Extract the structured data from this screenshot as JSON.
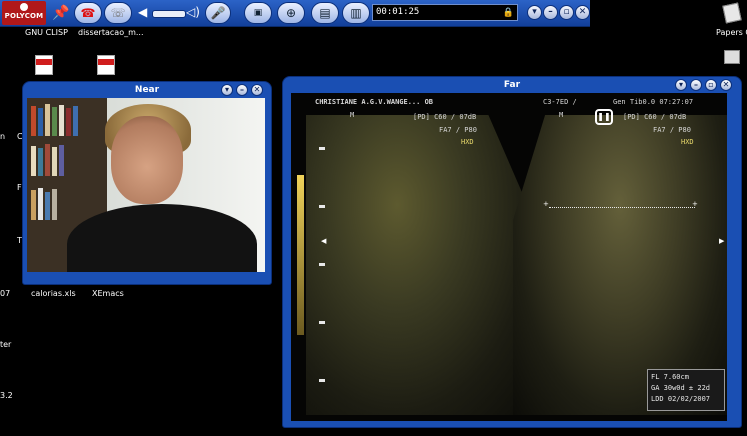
{
  "toolbar": {
    "logo_text": "POLYCOM",
    "timer": "00:01:25",
    "icons": [
      "pin-icon",
      "hangup-icon",
      "dial-icon",
      "speaker-icon",
      "volume-slider",
      "mic-icon",
      "near-camera-icon",
      "far-camera-icon",
      "pc-content-icon",
      "monitor-icon",
      "lock-icon"
    ],
    "window_buttons": [
      "▾",
      "–",
      "▫",
      "✕"
    ]
  },
  "desktop": {
    "icons": [
      {
        "label": "GNU CLISP"
      },
      {
        "label": "dissertacao_m..."
      },
      {
        "label": "calorias.xls"
      },
      {
        "label": "XEmacs"
      },
      {
        "label": "Papers C"
      }
    ],
    "edge_labels": [
      "n",
      "C",
      "T",
      "F",
      "T",
      "07",
      "ter",
      "3.2"
    ]
  },
  "near_window": {
    "title": "Near",
    "buttons": [
      "▾",
      "–",
      "✕"
    ]
  },
  "far_window": {
    "title": "Far",
    "buttons": [
      "▾",
      "–",
      "▫",
      "✕"
    ],
    "header_left": "CHRISTIANE A.G.V.WANGE... OB",
    "header_right_1": "C3-7ED /",
    "header_right_2": "Gen Tib0.0 07:27:07",
    "marker_left": "M",
    "marker_right": "M",
    "param_left_1": "[PD] C60 / 07dB",
    "param_left_2": "FA7 / P80",
    "param_left_3": "HXD",
    "param_right_1": "[PD] C60 / 07dB",
    "param_right_2": "FA7 / P80",
    "param_right_3": "HXD",
    "info_lines": [
      "FL  7.60cm",
      "GA 30w0d ± 22d",
      "LDD 02/02/2007"
    ]
  },
  "colors": {
    "toolbar_blue": "#1b4aa8",
    "window_blue": "#1a4fb3",
    "logo_red": "#b0181a",
    "desktop_bg": "#000000"
  }
}
